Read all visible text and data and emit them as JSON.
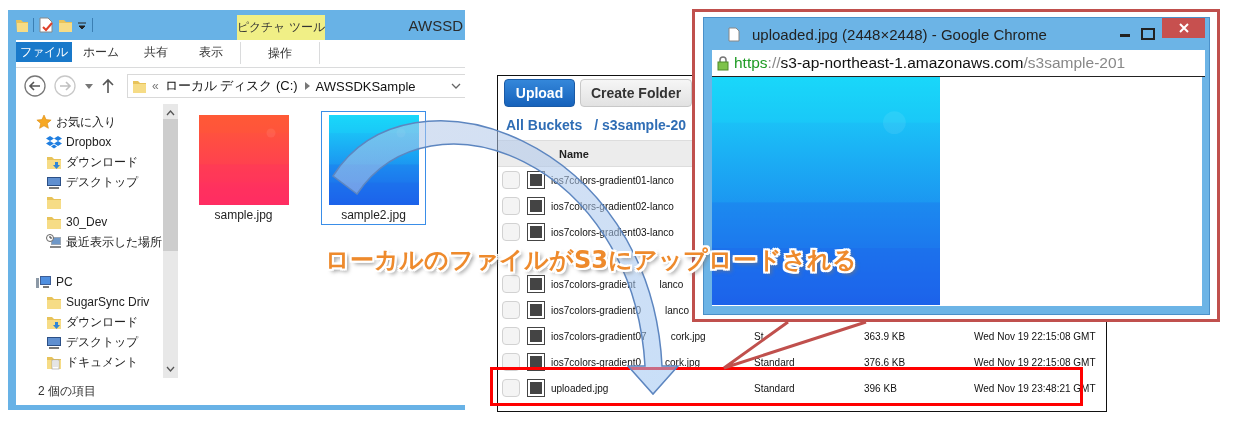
{
  "explorer": {
    "title": "AWSSD",
    "contextual_group": "ピクチャ ツール",
    "ribbon_tabs": [
      {
        "label": "ファイル",
        "selected": true,
        "contextual": false
      },
      {
        "label": "ホーム",
        "selected": false,
        "contextual": false
      },
      {
        "label": "共有",
        "selected": false,
        "contextual": false
      },
      {
        "label": "表示",
        "selected": false,
        "contextual": false
      },
      {
        "label": "操作",
        "selected": false,
        "contextual": true
      }
    ],
    "address": {
      "overflow": "«",
      "segments": [
        "ローカル ディスク (C:)",
        "AWSSDKSample"
      ]
    },
    "nav": [
      {
        "label": "お気に入り",
        "kind": "star",
        "children": [
          {
            "label": "Dropbox",
            "kind": "dropbox"
          },
          {
            "label": "ダウンロード",
            "kind": "download"
          },
          {
            "label": "デスクトップ",
            "kind": "desktop"
          },
          {
            "kind": "folder"
          },
          {
            "label": "30_Dev",
            "kind": "folder"
          },
          {
            "label": "最近表示した場所",
            "kind": "recent"
          }
        ]
      },
      {
        "label": "PC",
        "kind": "pc",
        "children": [
          {
            "label": "SugarSync Driv",
            "kind": "folder"
          },
          {
            "label": "ダウンロード",
            "kind": "download"
          },
          {
            "label": "デスクトップ",
            "kind": "desktop"
          },
          {
            "label": "ドキュメント",
            "kind": "document"
          }
        ]
      }
    ],
    "files": [
      {
        "name": "sample.jpg",
        "selected": false,
        "kind": "picture"
      },
      {
        "name": "sample2.jpg",
        "selected": true,
        "kind": "picture"
      }
    ],
    "status": "2 個の項目"
  },
  "s3": {
    "buttons": [
      {
        "label": "Upload",
        "kind": "primary"
      },
      {
        "label": "Create Folder",
        "kind": "default"
      }
    ],
    "breadcrumb": [
      "All Buckets",
      "/ s3sample-20"
    ],
    "column": "Name",
    "rows": [
      {
        "checked": false,
        "name": "ios7colors-gradient01-lanco"
      },
      {
        "checked": false,
        "name": "ios7colors-gradient02-lanco"
      },
      {
        "checked": false,
        "name": "ios7colors-gradient03-lanco"
      },
      {
        "kind": "covered"
      },
      {
        "checked": false,
        "name": "ios7colors-gradient",
        "name_end": "lanco"
      },
      {
        "checked": false,
        "name": "ios7colors-gradient0",
        "name_end": "lanco"
      },
      {
        "checked": false,
        "name": "ios7colors-gradient07",
        "name_end": "cork.jpg",
        "storage": "St",
        "size": "363.9 KB",
        "date": "Wed Nov 19 22:15:08 GMT"
      },
      {
        "checked": false,
        "name": "ios7colors-gradient0",
        "name_end": "cork.jpg",
        "storage": "Standard",
        "size": "376.6 KB",
        "date": "Wed Nov 19 22:15:08 GMT"
      },
      {
        "checked": false,
        "name": "uploaded.jpg",
        "storage": "Standard",
        "size": "396 KB",
        "date": "Wed Nov 19 23:48:21 GMT",
        "highlighted": true
      }
    ]
  },
  "chrome": {
    "title": "uploaded.jpg (2448×2448) - Google Chrome",
    "url": {
      "scheme": "https",
      "separator": "://",
      "host": "s3-ap-northeast-1.amazonaws.com",
      "path": "/s3sample-201"
    }
  },
  "caption": "ローカルのファイルがS3にアップロードされる"
}
